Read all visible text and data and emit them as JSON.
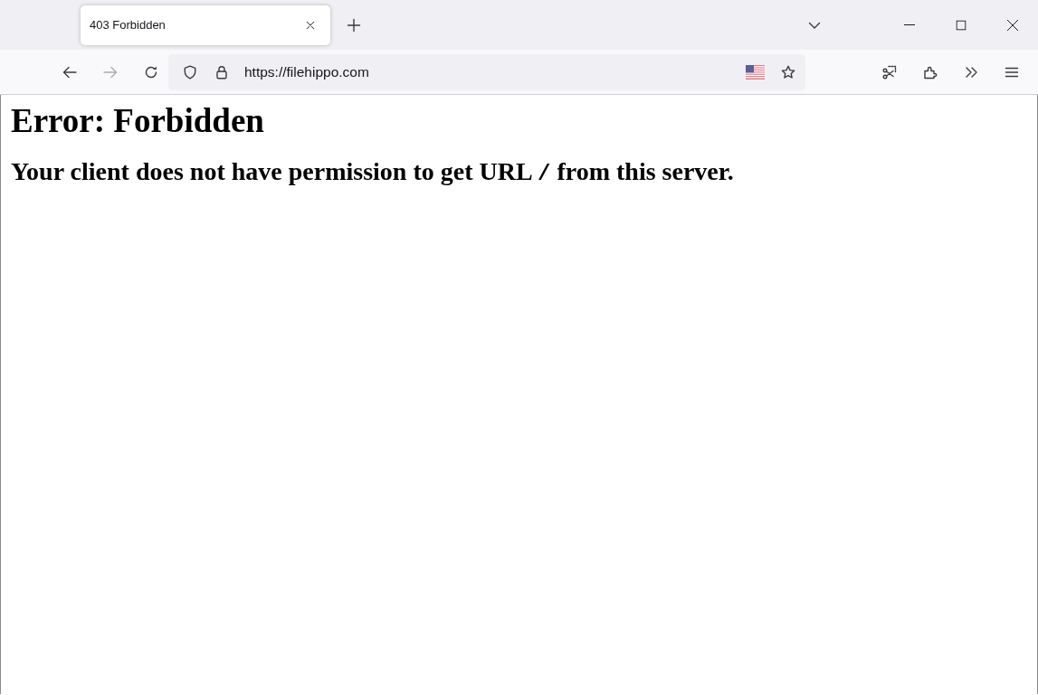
{
  "tabs": [
    {
      "title": "403 Forbidden",
      "selected": true
    }
  ],
  "navigation": {
    "back_disabled": false,
    "forward_disabled": true
  },
  "address_bar": {
    "url": "https://filehippo.com"
  },
  "page": {
    "heading": "Error: Forbidden",
    "message": {
      "before": "Your client does not have permission to get URL ",
      "code": "/",
      "after": " from this server."
    }
  }
}
